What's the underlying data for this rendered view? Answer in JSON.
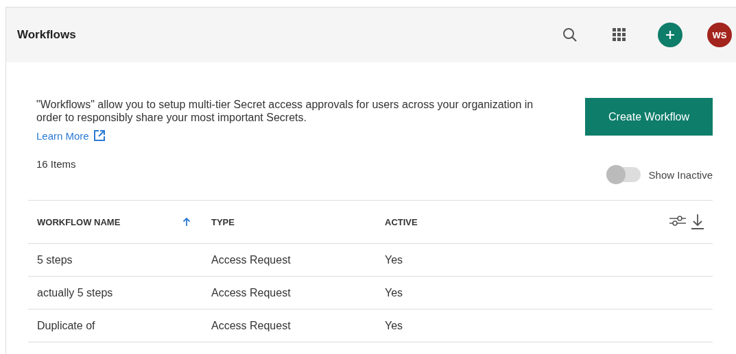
{
  "header": {
    "title": "Workflows",
    "avatar_initials": "WS"
  },
  "intro": {
    "description": "\"Workflows\" allow you to setup multi-tier Secret access approvals for users across your organization in order to responsibly share your most important Secrets.",
    "link": "Learn More",
    "item_count": "16 Items"
  },
  "create_button": "Create Workflow",
  "show_inactive": {
    "label": "Show Inactive",
    "on": false
  },
  "table": {
    "columns": [
      {
        "label": "WORKFLOW NAME",
        "sorted": true
      },
      {
        "label": "TYPE",
        "sorted": false
      },
      {
        "label": "ACTIVE",
        "sorted": false
      }
    ],
    "rows": [
      [
        "5 steps",
        "Access Request",
        "Yes"
      ],
      [
        "actually 5 steps",
        "Access Request",
        "Yes"
      ],
      [
        "Duplicate of",
        "Access Request",
        "Yes"
      ]
    ]
  }
}
